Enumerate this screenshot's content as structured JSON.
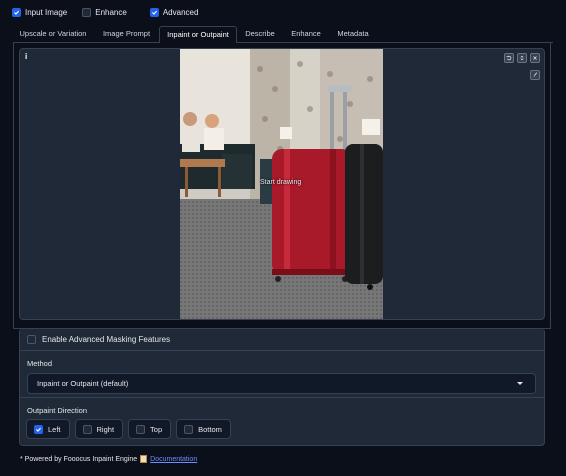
{
  "top_checkboxes": [
    {
      "label": "Input Image",
      "checked": true
    },
    {
      "label": "Enhance",
      "checked": false
    },
    {
      "label": "Advanced",
      "checked": true
    }
  ],
  "tabs": [
    {
      "label": "Upscale or Variation",
      "active": false
    },
    {
      "label": "Image Prompt",
      "active": false
    },
    {
      "label": "Inpaint or Outpaint",
      "active": true
    },
    {
      "label": "Describe",
      "active": false
    },
    {
      "label": "Enhance",
      "active": false
    },
    {
      "label": "Metadata",
      "active": false
    }
  ],
  "canvas": {
    "info_icon": "i",
    "overlay_text": "Start drawing",
    "tool_icons": [
      "undo-icon",
      "expand-icon",
      "close-icon"
    ],
    "brush_icon": "brush-icon"
  },
  "masking": {
    "advanced_label": "Enable Advanced Masking Features",
    "advanced_checked": false
  },
  "method": {
    "label": "Method",
    "selected": "Inpaint or Outpaint (default)"
  },
  "outpaint": {
    "label": "Outpaint Direction",
    "options": [
      {
        "label": "Left",
        "checked": true
      },
      {
        "label": "Right",
        "checked": false
      },
      {
        "label": "Top",
        "checked": false
      },
      {
        "label": "Bottom",
        "checked": false
      }
    ]
  },
  "footer": {
    "text": "* Powered by Fooocus Inpaint Engine",
    "link": "Documentation"
  },
  "colors": {
    "accent": "#2563eb",
    "background": "#0b0f19",
    "panel": "#1f2937",
    "link": "#6c8cff"
  }
}
